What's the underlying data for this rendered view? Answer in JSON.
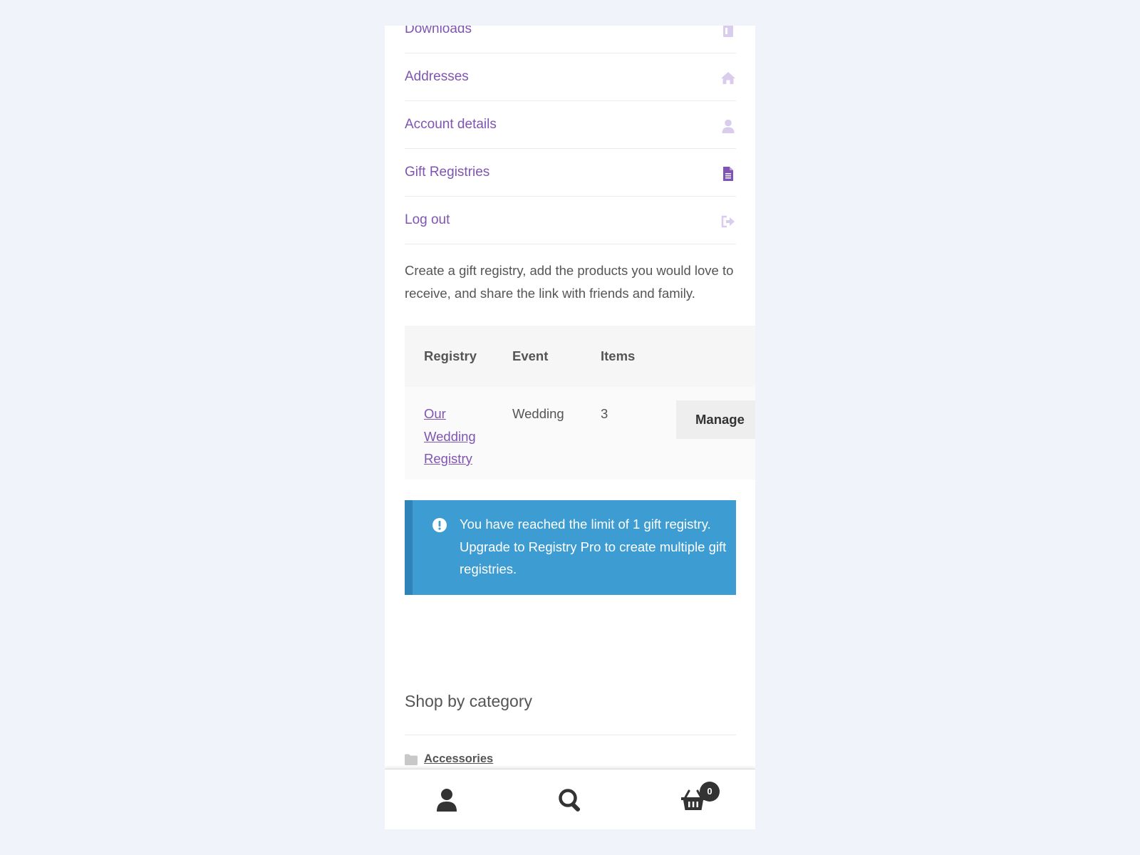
{
  "account_nav": {
    "items": [
      {
        "label": "Downloads",
        "icon": "file-download-icon"
      },
      {
        "label": "Addresses",
        "icon": "home-icon"
      },
      {
        "label": "Account details",
        "icon": "user-icon"
      },
      {
        "label": "Gift Registries",
        "icon": "document-icon",
        "active": true
      },
      {
        "label": "Log out",
        "icon": "sign-out-icon"
      }
    ]
  },
  "intro_text": "Create a gift registry, add the products you would love to receive, and share the link with friends and family.",
  "registry_table": {
    "headers": [
      "Registry",
      "Event",
      "Items"
    ],
    "rows": [
      {
        "registry": "Our Wedding Registry",
        "event": "Wedding",
        "items": "3",
        "action": "Manage"
      }
    ]
  },
  "notice": {
    "icon": "info-icon",
    "text": "You have reached the limit of 1 gift registry. Upgrade to Registry Pro to create multiple gift registries."
  },
  "shop_by_category": {
    "title": "Shop by category",
    "categories": [
      {
        "label": "Accessories",
        "icon": "folder-icon"
      }
    ]
  },
  "bottom_bar": {
    "account_icon": "user-icon",
    "search_icon": "search-icon",
    "cart_icon": "basket-icon",
    "cart_count": "0"
  },
  "colors": {
    "page_background": "#f0f3f9",
    "link_purple": "#7f54b3",
    "notice_blue": "#3d9cd2",
    "notice_border": "#2e83b7",
    "text_gray": "#555555"
  }
}
